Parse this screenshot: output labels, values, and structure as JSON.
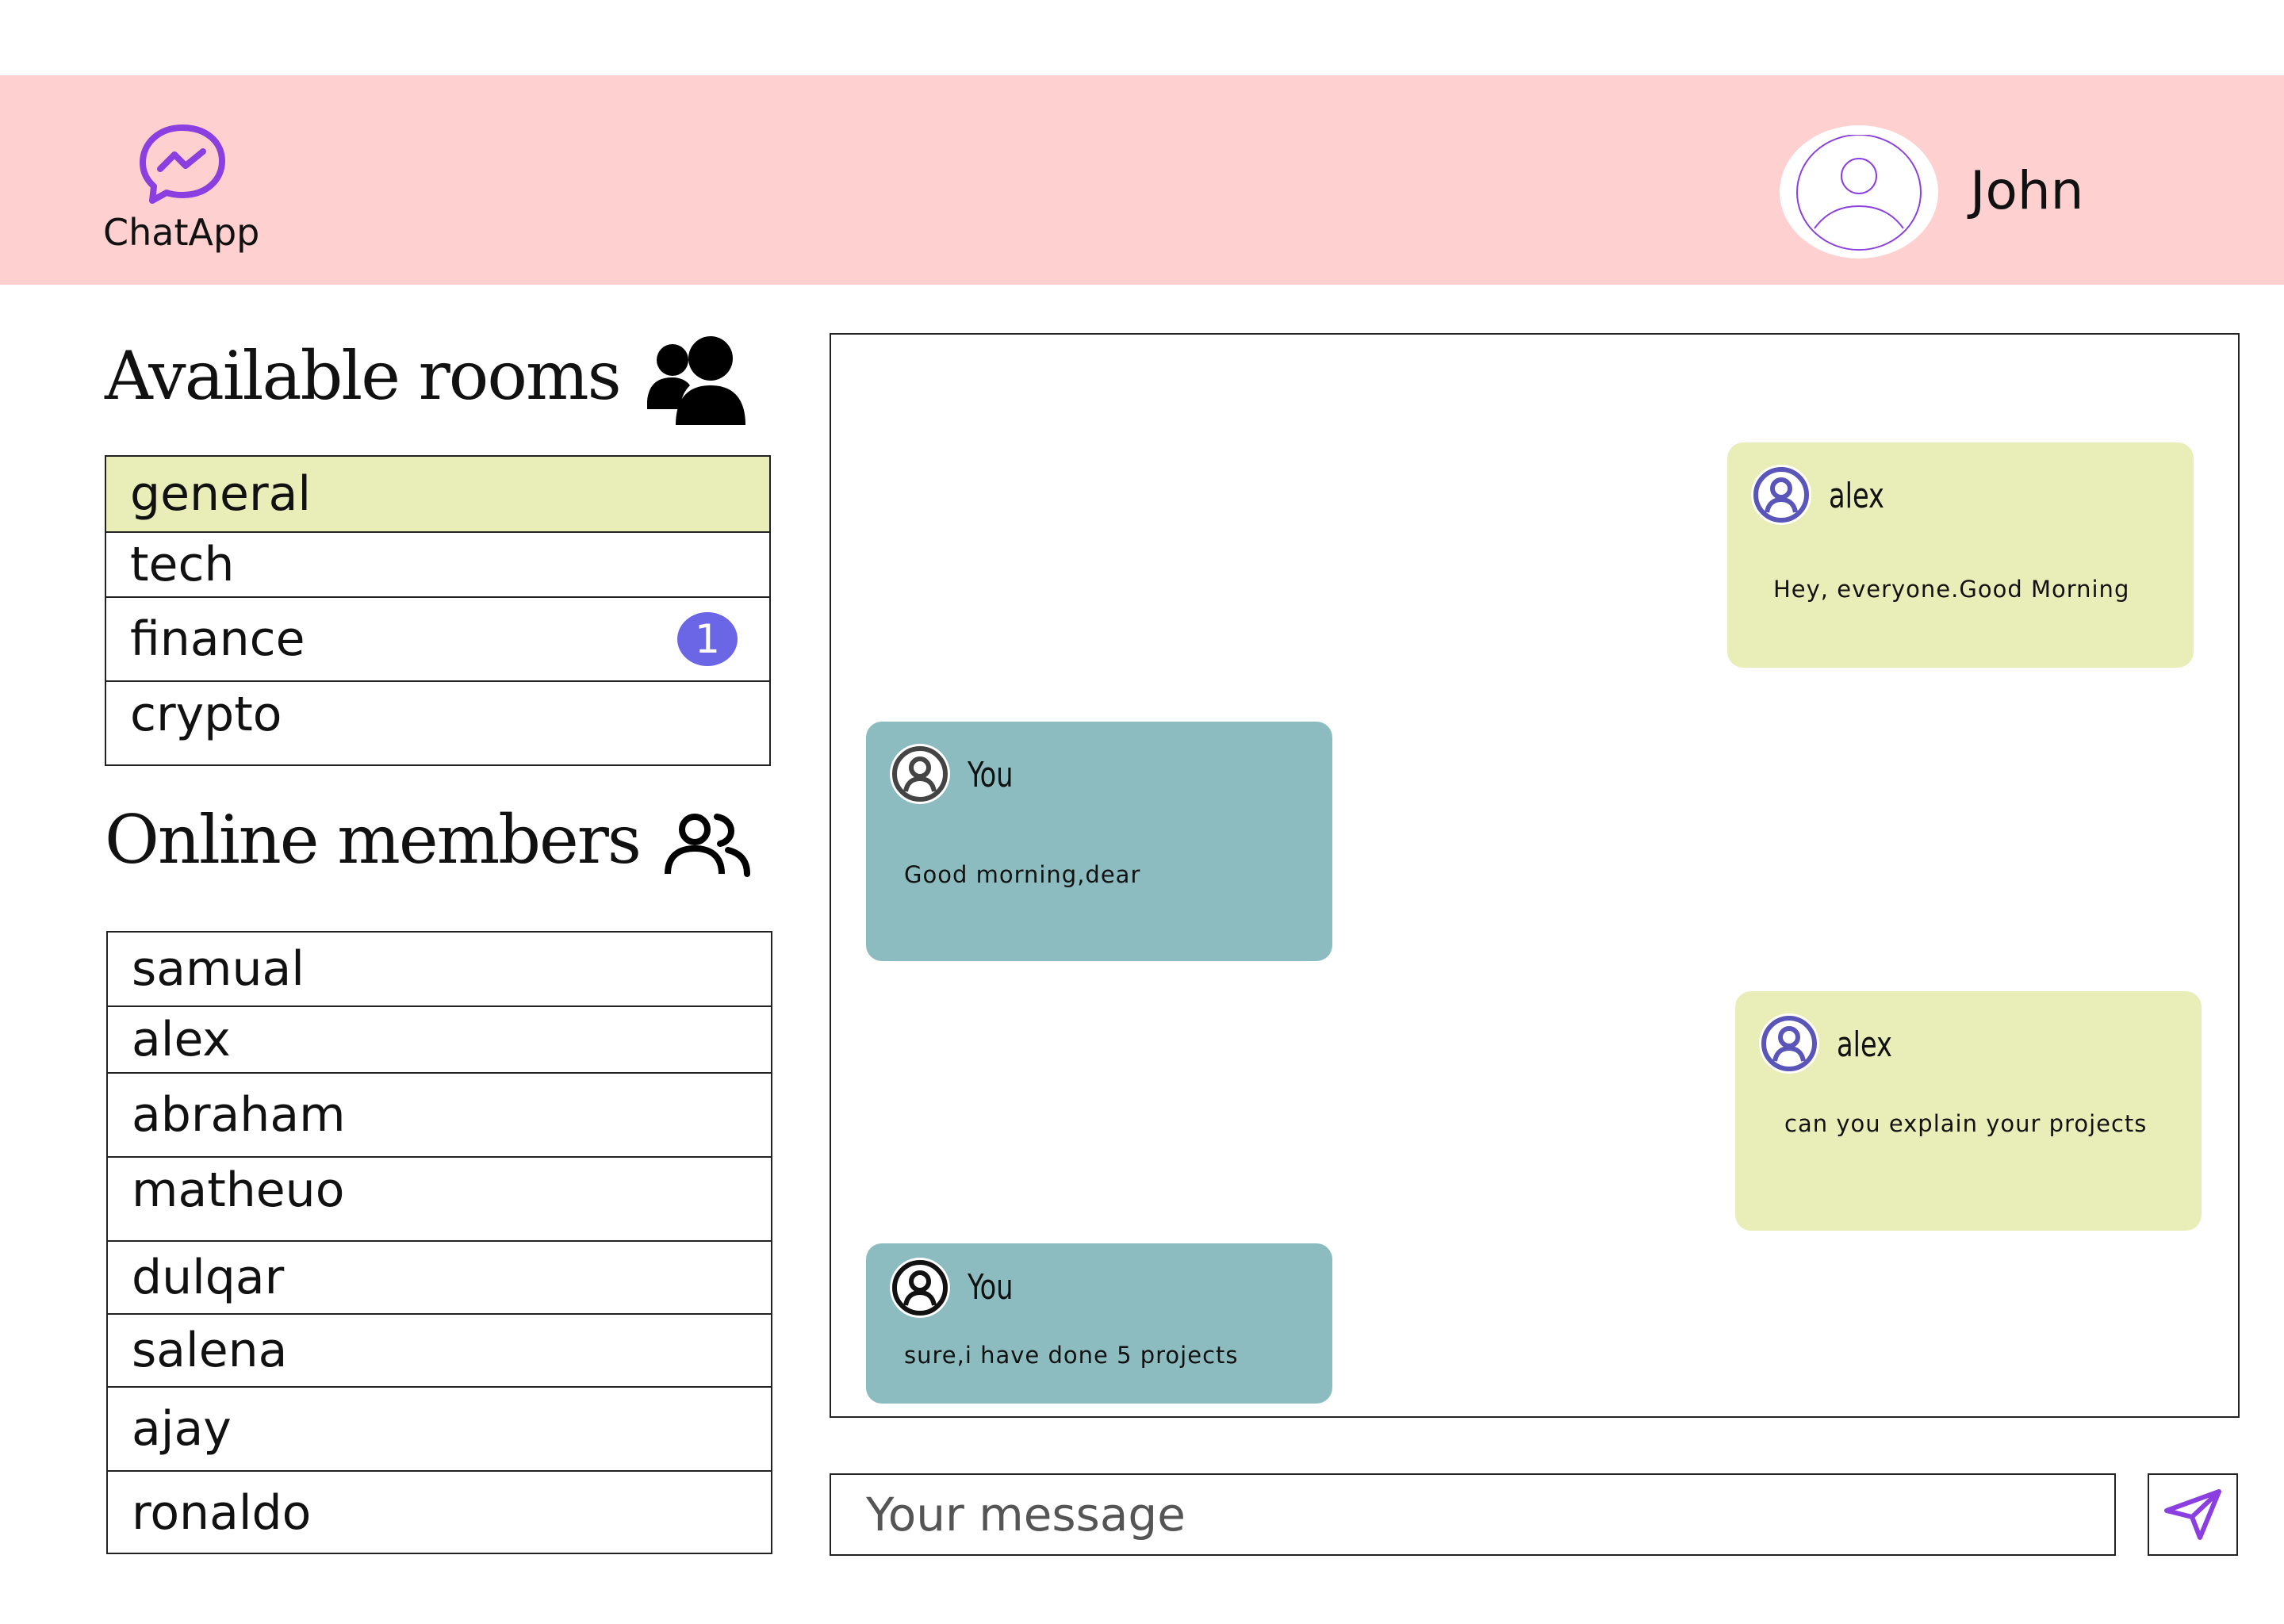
{
  "app": {
    "name": "ChatApp",
    "accent": "#8b3fe0"
  },
  "user": {
    "name": "John"
  },
  "rooms": {
    "title": "Available rooms",
    "items": [
      {
        "label": "general",
        "active": true
      },
      {
        "label": "tech"
      },
      {
        "label": "finance",
        "badge": "1"
      },
      {
        "label": "crypto"
      }
    ]
  },
  "members": {
    "title": "Online members",
    "items": [
      "samual",
      "alex",
      "abraham",
      "matheuo",
      "dulqar",
      "salena",
      "ajay",
      "ronaldo"
    ]
  },
  "messages": [
    {
      "sender": "alex",
      "text": "Hey, everyone.Good Morning",
      "mine": false
    },
    {
      "sender": "You",
      "text": "Good morning,dear",
      "mine": true
    },
    {
      "sender": "alex",
      "text": "can you explain your projects",
      "mine": false
    },
    {
      "sender": "You",
      "text": "sure,i have done 5 projects",
      "mine": true
    }
  ],
  "composer": {
    "placeholder": "Your message"
  },
  "colors": {
    "header_bg": "#ffd0d0",
    "active_room_bg": "#e9eeb8",
    "other_bubble": "#e9eeb8",
    "my_bubble": "#8cbcbf",
    "badge": "#6b66e6"
  }
}
